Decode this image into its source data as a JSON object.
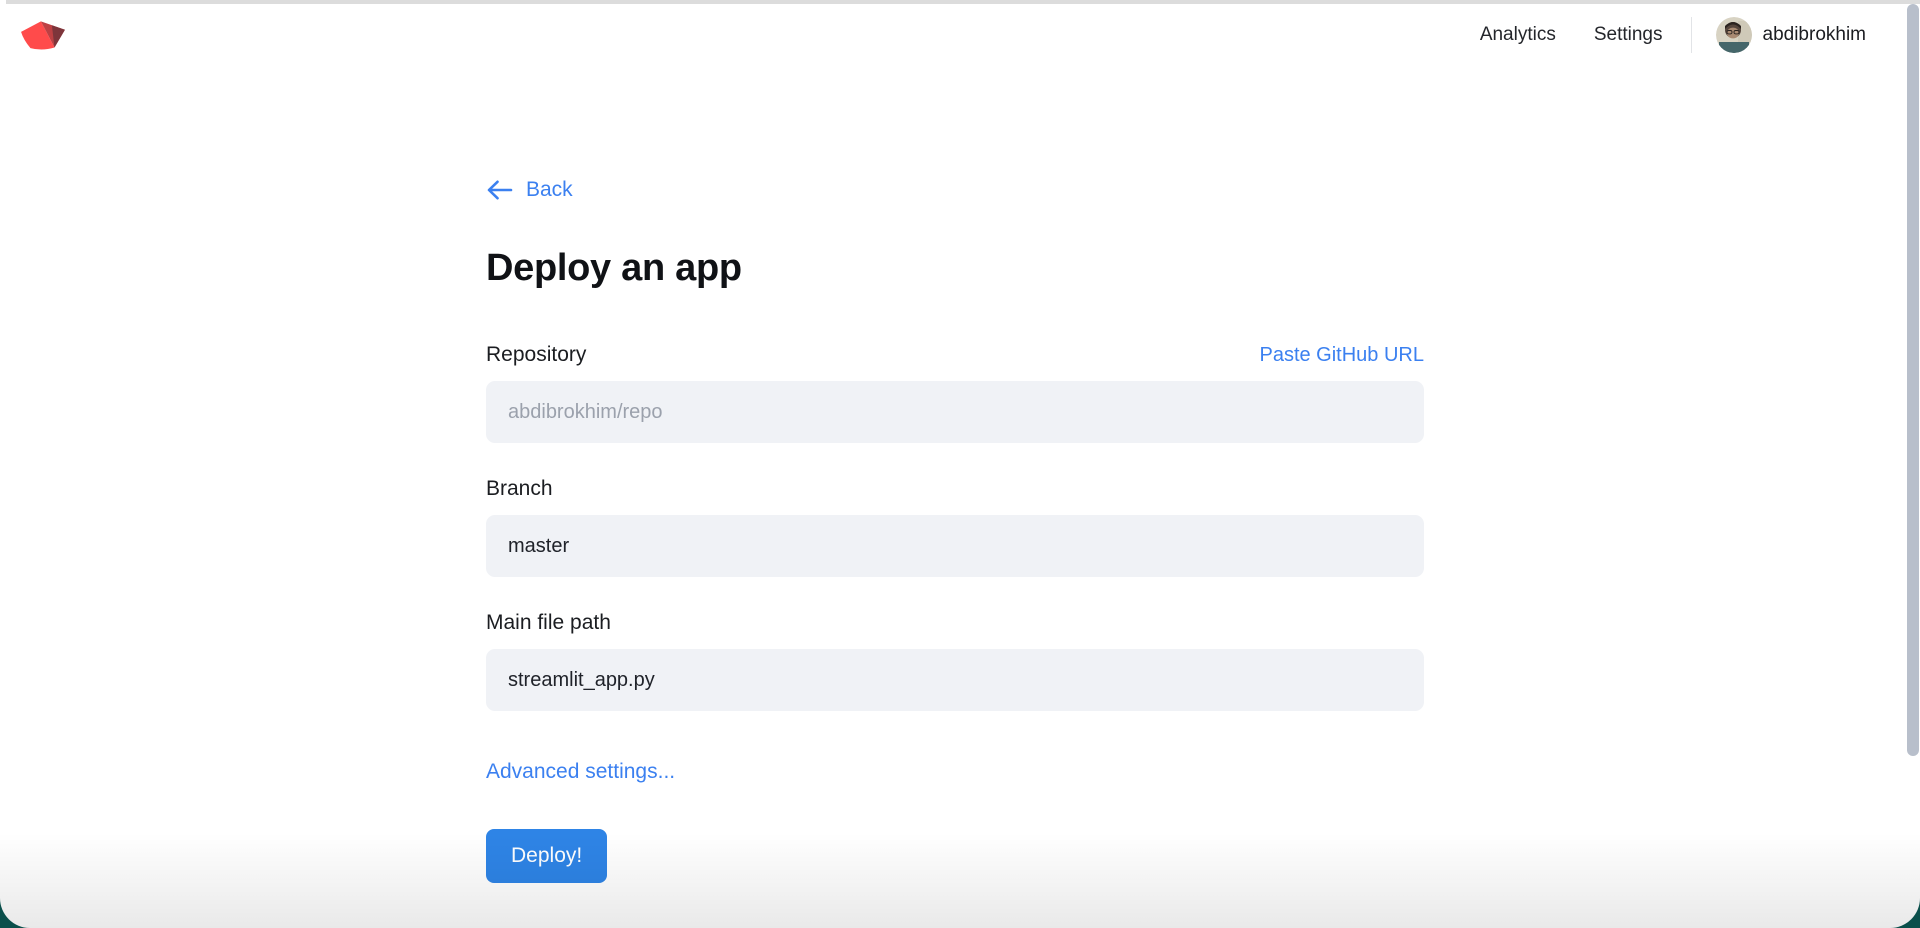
{
  "topnav": {
    "analytics_label": "Analytics",
    "settings_label": "Settings",
    "username": "abdibrokhim"
  },
  "deploy_form": {
    "back_label": "Back",
    "title": "Deploy an app",
    "repository_label": "Repository",
    "paste_github_url_label": "Paste GitHub URL",
    "repository_placeholder": "abdibrokhim/repo",
    "branch_label": "Branch",
    "branch_value": "master",
    "main_file_path_label": "Main file path",
    "main_file_path_value": "streamlit_app.py",
    "advanced_settings_label": "Advanced settings...",
    "deploy_button_label": "Deploy!"
  },
  "colors": {
    "accent_blue": "#3b80f0",
    "button_blue": "#2e84e6",
    "input_background": "#f0f2f6",
    "backdrop_teal": "#0a4f4b",
    "logo_red": "#ff4b4b",
    "logo_red_mid": "#bd4043",
    "logo_red_dark": "#7d353b"
  }
}
